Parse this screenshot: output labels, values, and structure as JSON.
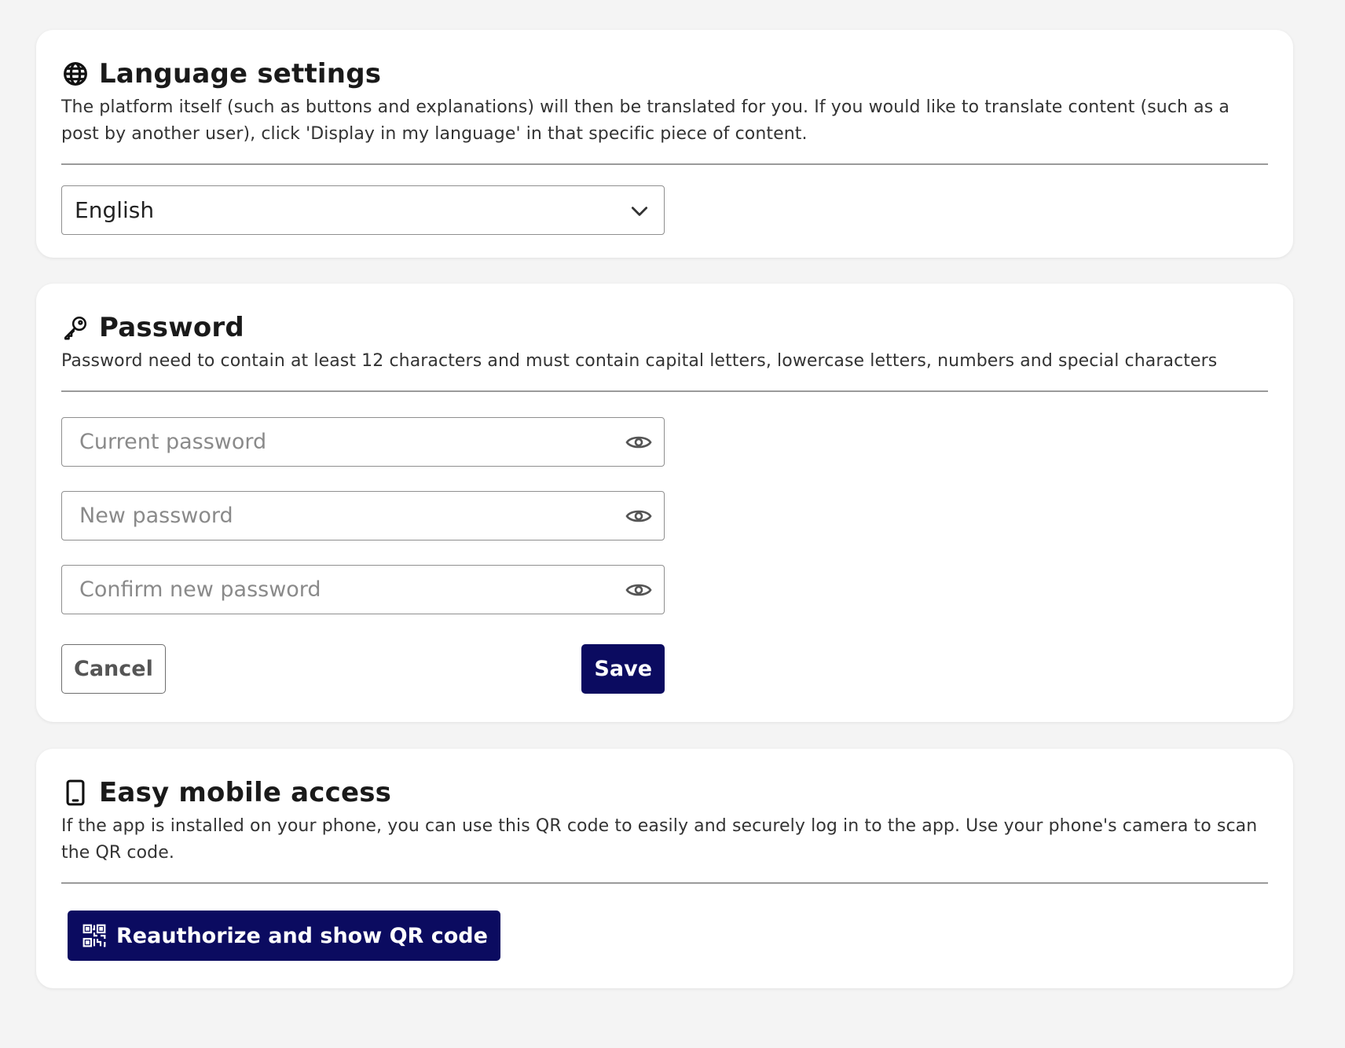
{
  "language": {
    "icon": "globe-icon",
    "title": "Language settings",
    "description": "The platform itself (such as buttons and explanations) will then be translated for you. If you would like to translate content (such as a post by another user), click 'Display in my language' in that specific piece of content.",
    "selected": "English"
  },
  "password": {
    "icon": "key-icon",
    "title": "Password",
    "description": "Password need to contain at least 12 characters and must contain capital letters, lowercase letters, numbers and special characters",
    "fields": {
      "current_placeholder": "Current password",
      "new_placeholder": "New password",
      "confirm_placeholder": "Confirm new password"
    },
    "cancel_label": "Cancel",
    "save_label": "Save"
  },
  "mobile": {
    "icon": "smartphone-icon",
    "title": "Easy mobile access",
    "description": "If the app is installed on your phone, you can use this QR code to easily and securely log in to the app. Use your phone's camera to scan the QR code.",
    "button_label": "Reauthorize and show QR code",
    "button_icon": "qr-code-icon"
  },
  "colors": {
    "primary": "#0b0b60",
    "background": "#f4f4f4",
    "card": "#ffffff"
  }
}
